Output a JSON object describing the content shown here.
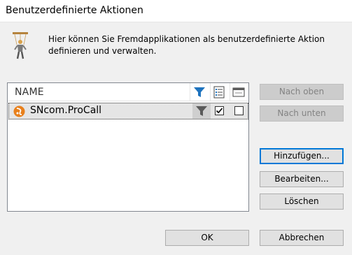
{
  "window": {
    "title": "Benutzerdefinierte Aktionen"
  },
  "intro": {
    "text": "Hier können Sie Fremdapplikationen als benutzerdefinierte Aktion definieren und verwalten."
  },
  "list": {
    "columns": {
      "name": "NAME"
    },
    "header_icons": [
      "filter-icon",
      "list-details-icon",
      "window-icon"
    ],
    "rows": [
      {
        "name": "SNcom.ProCall",
        "icon": "procall-logo-icon",
        "filter": "filter-icon",
        "checked_1": true,
        "checked_2": false
      }
    ]
  },
  "buttons": {
    "up": "Nach oben",
    "down": "Nach unten",
    "add": "Hinzufügen...",
    "edit": "Bearbeiten...",
    "delete": "Löschen",
    "ok": "OK",
    "cancel": "Abbrechen"
  },
  "colors": {
    "accent": "#0078d7",
    "filter_blue": "#1e73be",
    "logo_orange": "#e8801c",
    "selection": "#e5e5e5"
  }
}
